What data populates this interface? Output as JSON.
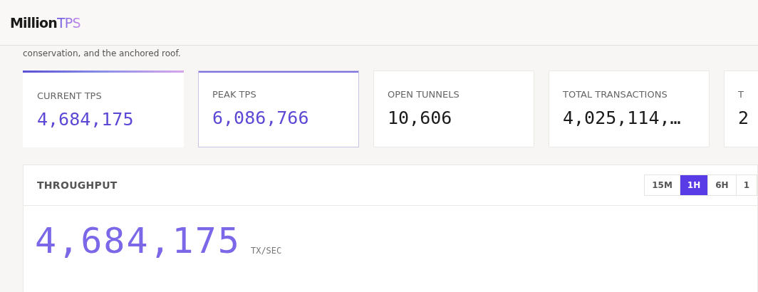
{
  "header": {
    "logo_main": "Million",
    "logo_accent": "TPS"
  },
  "intro": "conservation, and the anchored roof.",
  "stats": [
    {
      "label": "CURRENT TPS",
      "value": "4,684,175",
      "accent": true,
      "outlined": false
    },
    {
      "label": "PEAK TPS",
      "value": "6,086,766",
      "accent": true,
      "outlined": true
    },
    {
      "label": "OPEN TUNNELS",
      "value": "10,606",
      "accent": false,
      "outlined": false
    },
    {
      "label": "TOTAL TRANSACTIONS",
      "value": "4,025,114,…",
      "accent": false,
      "outlined": false
    },
    {
      "label": "T",
      "value": "2",
      "accent": false,
      "outlined": false
    }
  ],
  "throughput": {
    "title": "THROUGHPUT",
    "ranges": [
      {
        "label": "15M",
        "selected": false
      },
      {
        "label": "1H",
        "selected": true
      },
      {
        "label": "6H",
        "selected": false
      },
      {
        "label": "1",
        "selected": false
      }
    ],
    "value": "4,684,175",
    "unit": "TX/SEC"
  }
}
